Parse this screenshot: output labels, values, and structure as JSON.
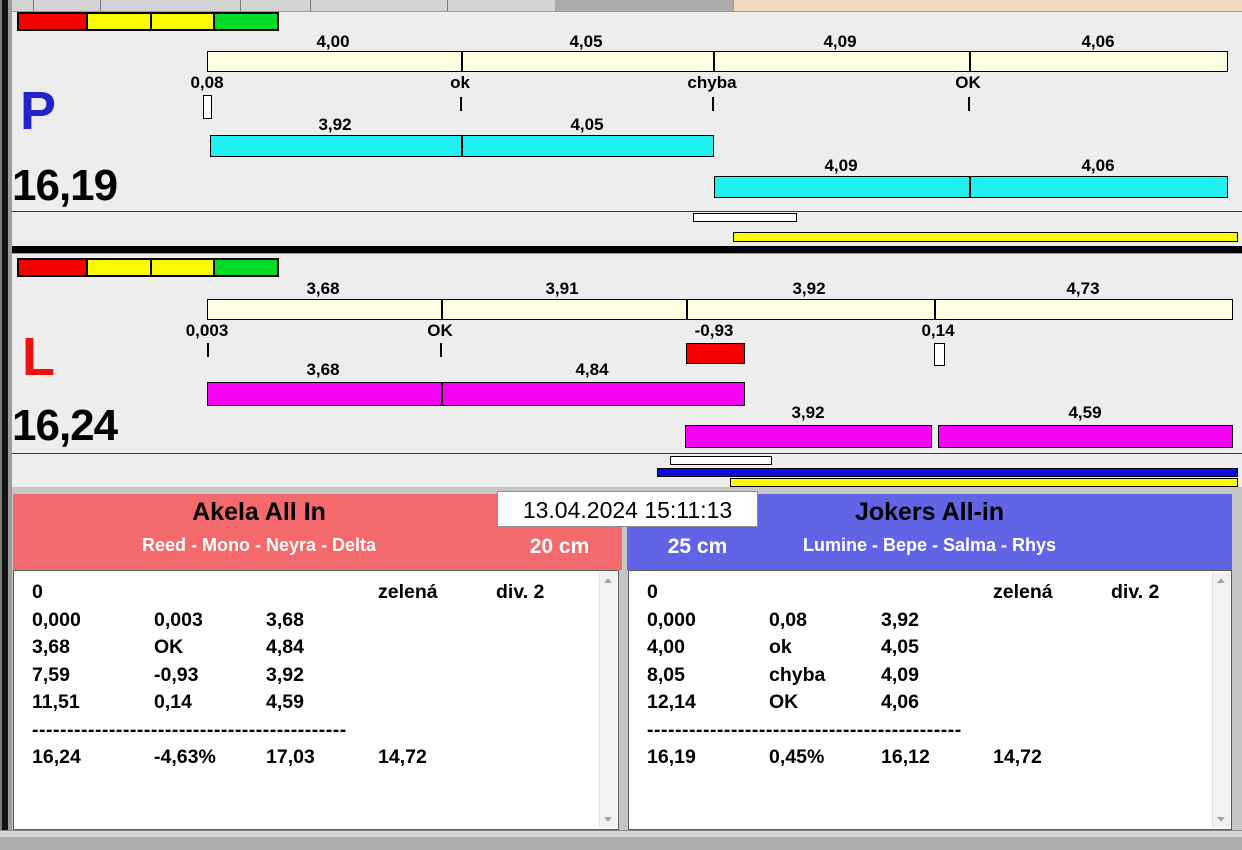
{
  "datetime": "13.04.2024 15:11:13",
  "colors": {
    "red": "#F80000",
    "yellow": "#FCFC00",
    "green": "#00DC28",
    "cream": "#FDFDE2",
    "cyan": "#1FEFEF",
    "magenta": "#F502F5",
    "blue_bar": "#0D0DDF",
    "team_left_bg": "#F4696B",
    "team_right_bg": "#6165E5",
    "lane_p_letter": "#2323CE",
    "lane_l_letter": "#EE1111"
  },
  "lanes": {
    "p": {
      "letter": "P",
      "total": "16,19",
      "lights": [
        "red",
        "yellow",
        "yellow",
        "green"
      ],
      "ruler_labels": [
        "4,00",
        "4,05",
        "4,09",
        "4,06"
      ],
      "mark_labels": [
        "0,08",
        "ok",
        "chyba",
        "OK"
      ],
      "run1_labels": [
        "3,92",
        "4,05"
      ],
      "run2_labels": [
        "4,09",
        "4,06"
      ]
    },
    "l": {
      "letter": "L",
      "total": "16,24",
      "lights": [
        "red",
        "yellow",
        "yellow",
        "green"
      ],
      "ruler_labels": [
        "3,68",
        "3,91",
        "3,92",
        "4,73"
      ],
      "mark_labels": [
        "0,003",
        "OK",
        "-0,93",
        "0,14"
      ],
      "run1_labels": [
        "3,68",
        "4,84"
      ],
      "run2_labels": [
        "3,92",
        "4,59"
      ]
    }
  },
  "teams": {
    "left": {
      "name": "Akela All In",
      "dogs": "Reed - Mono - Neyra - Delta",
      "height": "20 cm",
      "table": {
        "rows": [
          [
            "0",
            "",
            "",
            "zelená",
            "div. 2"
          ],
          [
            "0,000",
            "0,003",
            "3,68",
            "",
            ""
          ],
          [
            "3,68",
            "OK",
            "4,84",
            "",
            ""
          ],
          [
            "7,59",
            "-0,93",
            "3,92",
            "",
            ""
          ],
          [
            "11,51",
            "0,14",
            "4,59",
            "",
            ""
          ]
        ],
        "separator": "---------------------------------------------",
        "total": [
          "16,24",
          "-4,63%",
          "17,03",
          "14,72",
          ""
        ]
      }
    },
    "right": {
      "name": "Jokers All-in",
      "dogs": "Lumine - Bepe - Salma - Rhys",
      "height": "25 cm",
      "table": {
        "rows": [
          [
            "0",
            "",
            "",
            "zelená",
            "div. 2"
          ],
          [
            "0,000",
            "0,08",
            "3,92",
            "",
            ""
          ],
          [
            "4,00",
            "ok",
            "4,05",
            "",
            ""
          ],
          [
            "8,05",
            "chyba",
            "4,09",
            "",
            ""
          ],
          [
            "12,14",
            "OK",
            "4,06",
            "",
            ""
          ]
        ],
        "separator": "---------------------------------------------",
        "total": [
          "16,19",
          "0,45%",
          "16,12",
          "14,72",
          ""
        ]
      }
    }
  }
}
